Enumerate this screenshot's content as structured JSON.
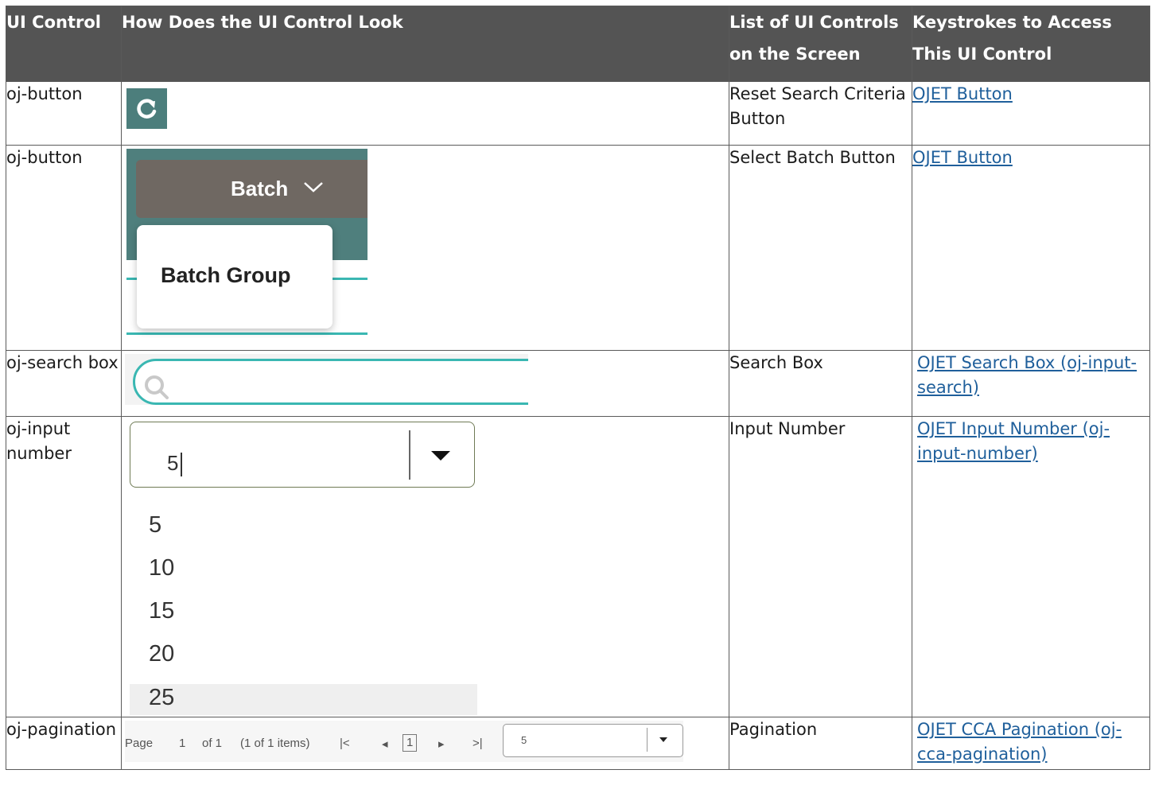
{
  "headers": {
    "col1": "UI Control",
    "col2": "How Does the UI Control Look",
    "col3": "List of UI Controls on the Screen",
    "col4": "Keystrokes to Access This UI Control"
  },
  "rows": [
    {
      "control": "oj-button",
      "list_name": "Reset Search Criteria Button",
      "link": "OJET  Button ",
      "icon": "refresh-icon"
    },
    {
      "control": "oj-button",
      "list_name": "Select Batch Button",
      "link": "OJET  Button ",
      "visual": {
        "button_label": "Batch",
        "menu_item": "Batch Group"
      }
    },
    {
      "control": "oj-search box",
      "list_name": "Search Box",
      "link": "OJET Search Box (oj-input-search)",
      "icon": "search-icon"
    },
    {
      "control": "oj-input number",
      "list_name": "Input Number",
      "link": "OJET Input Number (oj-input-number)",
      "visual": {
        "value": "5",
        "options": [
          "5",
          "10",
          "15",
          "20",
          "25"
        ]
      }
    },
    {
      "control": "oj-pagination",
      "list_name": "Pagination",
      "link": "OJET CCA Pagination (oj-cca-pagination)",
      "visual": {
        "page_label": "Page",
        "page_value": "1",
        "of_label": "of 1",
        "items_label": "(1 of 1 items)",
        "current_page": "1",
        "page_size": "5",
        "first_glyph": "|<",
        "prev_glyph": "◂",
        "next_glyph": "▸",
        "last_glyph": ">|"
      }
    }
  ],
  "colors": {
    "header_bg": "#545454",
    "teal": "#3ab7b2",
    "link": "#1f5f9b",
    "batch_button": "#6f6862"
  }
}
